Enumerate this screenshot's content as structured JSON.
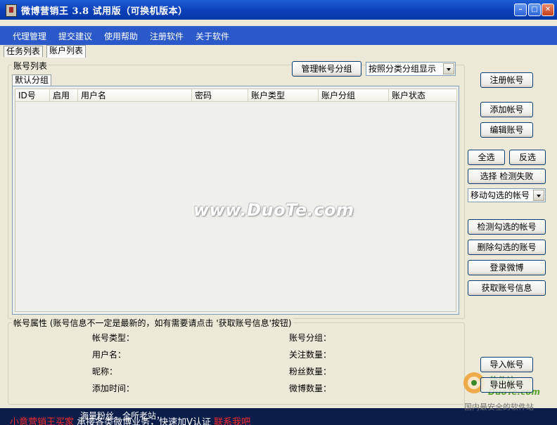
{
  "window": {
    "title": "微博营销王 3.8 试用版（可换机版本）"
  },
  "menu": [
    "代理管理",
    "提交建议",
    "使用帮助",
    "注册软件",
    "关于软件"
  ],
  "tabs": [
    "任务列表",
    "账户列表"
  ],
  "account_list": {
    "group_title": "账号列表",
    "manage_group_button": "管理帐号分组",
    "display_mode_select": "按照分类分组显示",
    "inner_tab": "默认分组",
    "columns": [
      "ID号",
      "启用",
      "用户名",
      "密码",
      "账户类型",
      "账户分组",
      "账户状态"
    ]
  },
  "watermark": "www.DuoTe.com",
  "right_panel": {
    "register_button": "注册帐号",
    "add_button": "添加帐号",
    "edit_button": "编辑账号",
    "select_all_button": "全选",
    "invert_button": "反选",
    "select_failed_button": "选择 检测失败",
    "move_select": "移动勾选的帐号",
    "check_selected_button": "检测勾选的帐号",
    "delete_selected_button": "删除勾选的账号",
    "login_weibo_button": "登录微博",
    "fetch_info_button": "获取账号信息",
    "import_button": "导入帐号",
    "export_button": "导出帐号"
  },
  "properties": {
    "title": "帐号属性 (账号信息不一定是最新的，如有需要请点击 '获取账号信息'按钮)",
    "account_type_label": "帐号类型：",
    "username_label": "用户名：",
    "nickname_label": "昵称：",
    "added_time_label": "添加时间：",
    "account_group_label": "账号分组：",
    "follow_count_label": "关注数量：",
    "fans_count_label": "粉丝数量：",
    "weibo_count_label": "微博数量："
  },
  "ads": {
    "line1_mid": "海量粉丝，全所老站，",
    "line2_red": "小意营销王买家",
    "line2_white": "承接各类微博业务，快速加V认证",
    "line2_tail": "联系我吧"
  },
  "corner_logo": {
    "name": "软件站",
    "url": "DuoTe.com",
    "slogan": "国内最安全的软件站"
  }
}
